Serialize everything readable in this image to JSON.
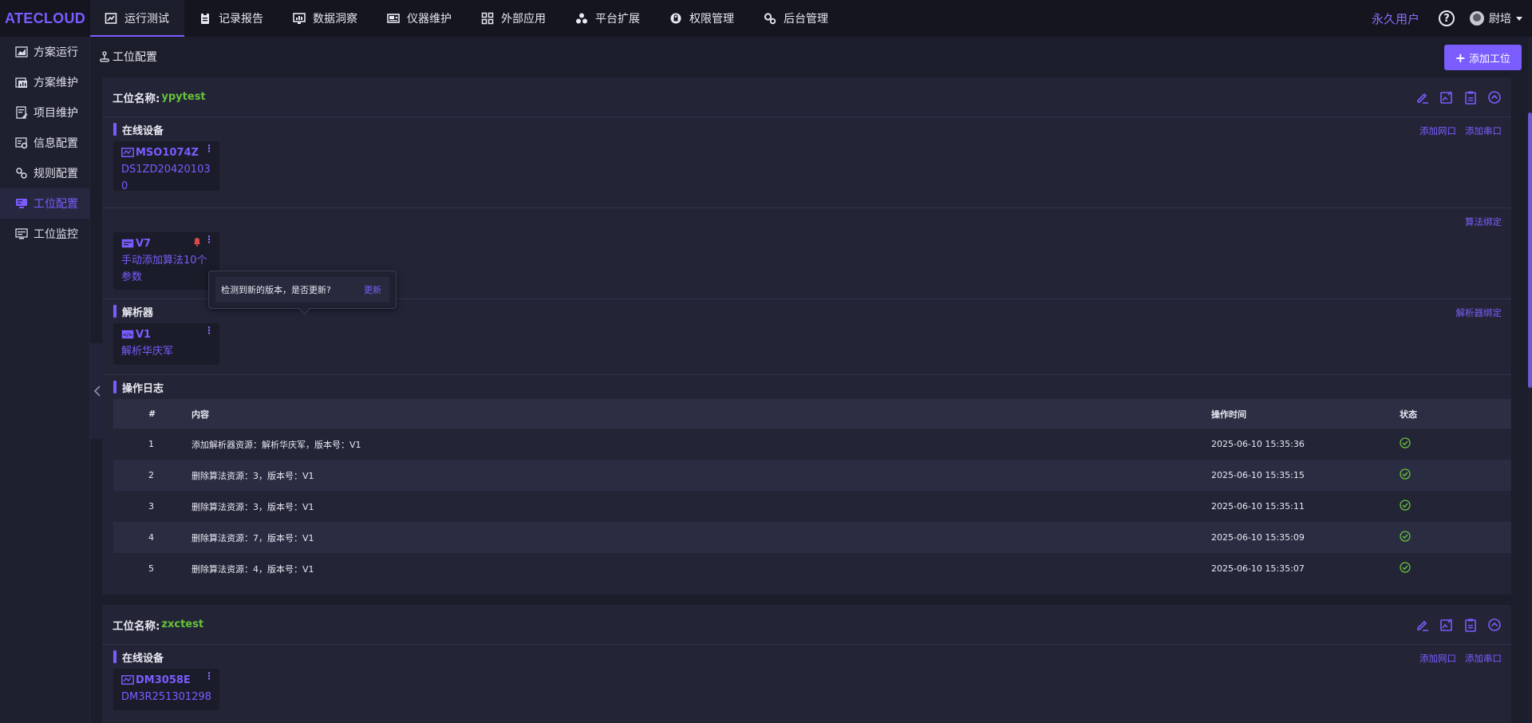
{
  "logo": "ATECLOUD",
  "nav": [
    {
      "label": "运行测试",
      "icon": "chart-icon",
      "active": true
    },
    {
      "label": "记录报告",
      "icon": "clipboard-icon"
    },
    {
      "label": "数据洞察",
      "icon": "monitor-chart-icon"
    },
    {
      "label": "仪器维护",
      "icon": "instrument-icon"
    },
    {
      "label": "外部应用",
      "icon": "grid-icon"
    },
    {
      "label": "平台扩展",
      "icon": "cluster-icon"
    },
    {
      "label": "权限管理",
      "icon": "lock-icon"
    },
    {
      "label": "后台管理",
      "icon": "gears-icon"
    }
  ],
  "top_right": {
    "license": "永久用户",
    "help": "?",
    "username": "尉培"
  },
  "sidebar": [
    {
      "label": "方案运行",
      "icon": "area-chart-icon"
    },
    {
      "label": "方案维护",
      "icon": "folder-chart-icon"
    },
    {
      "label": "项目维护",
      "icon": "doc-edit-icon"
    },
    {
      "label": "信息配置",
      "icon": "info-config-icon"
    },
    {
      "label": "规则配置",
      "icon": "rule-config-icon"
    },
    {
      "label": "工位配置",
      "icon": "station-config-icon",
      "active": true
    },
    {
      "label": "工位监控",
      "icon": "station-monitor-icon"
    }
  ],
  "page": {
    "title": "工位配置",
    "add_button": "添加工位"
  },
  "card1": {
    "label": "工位名称:",
    "name": "ypytest",
    "online": {
      "title": "在线设备",
      "links": [
        "添加网口",
        "添加串口"
      ],
      "device": {
        "name": "MSO1074Z",
        "serial": "DS1ZD204201030"
      }
    },
    "algo": {
      "link": "算法绑定",
      "item": {
        "name": "V7",
        "desc": "手动添加算法10个参数"
      }
    },
    "tooltip": {
      "text": "检测到新的版本，是否更新?",
      "action": "更新"
    },
    "parser": {
      "title": "解析器",
      "link": "解析器绑定",
      "item": {
        "name": "V1",
        "desc": "解析华庆军"
      }
    },
    "log": {
      "title": "操作日志",
      "columns": [
        "#",
        "内容",
        "操作时间",
        "状态"
      ],
      "rows": [
        {
          "num": "1",
          "content": "添加解析器资源：解析华庆军，版本号：V1",
          "time": "2025-06-10 15:35:36"
        },
        {
          "num": "2",
          "content": "删除算法资源：3，版本号：V1",
          "time": "2025-06-10 15:35:15"
        },
        {
          "num": "3",
          "content": "删除算法资源：3，版本号：V1",
          "time": "2025-06-10 15:35:11"
        },
        {
          "num": "4",
          "content": "删除算法资源：7，版本号：V1",
          "time": "2025-06-10 15:35:09"
        },
        {
          "num": "5",
          "content": "删除算法资源：4，版本号：V1",
          "time": "2025-06-10 15:35:07"
        }
      ]
    }
  },
  "card2": {
    "label": "工位名称:",
    "name": "zxctest",
    "online": {
      "title": "在线设备",
      "links": [
        "添加网口",
        "添加串口"
      ],
      "device": {
        "name": "DM3058E",
        "serial": "DM3R251301298"
      }
    }
  },
  "colors": {
    "accent": "#7a5cff",
    "ok": "#67c23a",
    "alert": "#e0474c"
  }
}
